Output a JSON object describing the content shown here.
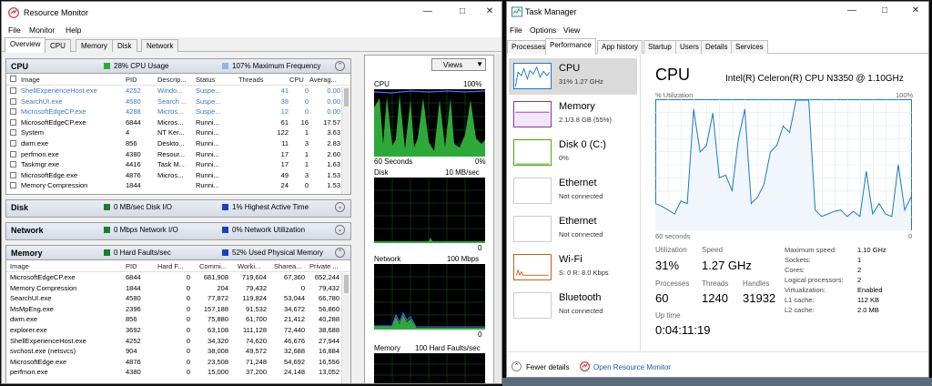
{
  "rm": {
    "title": "Resource Monitor",
    "menu": [
      "File",
      "Monitor",
      "Help"
    ],
    "tabs": [
      "Overview",
      "CPU",
      "Memory",
      "Disk",
      "Network"
    ],
    "cpu": {
      "name": "CPU",
      "ind1": "28% CPU Usage",
      "ind2": "107% Maximum Frequency",
      "columns": [
        "Image",
        "PID",
        "Descrip...",
        "Status",
        "Threads",
        "CPU",
        "Averag..."
      ],
      "rows": [
        [
          "ShellExperienceHost.exe",
          "4252",
          "Windo...",
          "Suspe...",
          "41",
          "0",
          "0.00"
        ],
        [
          "SearchUI.exe",
          "4580",
          "Search ...",
          "Suspe...",
          "38",
          "0",
          "0.00"
        ],
        [
          "MicrosoftEdgeCP.exe",
          "4288",
          "Micros...",
          "Suspe...",
          "12",
          "0",
          "0.00"
        ],
        [
          "MicrosoftEdgeCP.exe",
          "6844",
          "Micros...",
          "Runni...",
          "61",
          "16",
          "17.57"
        ],
        [
          "System",
          "4",
          "NT Ker...",
          "Runni...",
          "122",
          "1",
          "3.63"
        ],
        [
          "dwm.exe",
          "856",
          "Deskto...",
          "Runni...",
          "11",
          "3",
          "2.83"
        ],
        [
          "perfmon.exe",
          "4380",
          "Resour...",
          "Runni...",
          "17",
          "1",
          "2.60"
        ],
        [
          "Taskmgr.exe",
          "4416",
          "Task M...",
          "Runni...",
          "17",
          "1",
          "1.63"
        ],
        [
          "MicrosoftEdge.exe",
          "4876",
          "Micros...",
          "Runni...",
          "49",
          "3",
          "1.53"
        ],
        [
          "Memory Compression",
          "1844",
          "",
          "Runni...",
          "24",
          "0",
          "1.53"
        ]
      ]
    },
    "disk": {
      "name": "Disk",
      "ind1": "0 MB/sec Disk I/O",
      "ind2": "1% Highest Active Time"
    },
    "network": {
      "name": "Network",
      "ind1": "0 Mbps Network I/O",
      "ind2": "0% Network Utilization"
    },
    "memory": {
      "name": "Memory",
      "ind1": "0 Hard Faults/sec",
      "ind2": "52% Used Physical Memory",
      "columns": [
        "Image",
        "PID",
        "Hard F...",
        "Commi...",
        "Worki...",
        "Sharea...",
        "Private ..."
      ],
      "rows": [
        [
          "MicrosoftEdgeCP.exe",
          "6844",
          "0",
          "681,908",
          "719,604",
          "67,360",
          "652,244"
        ],
        [
          "Memory Compression",
          "1844",
          "0",
          "204",
          "79,432",
          "0",
          "79,432"
        ],
        [
          "SearchUI.exe",
          "4580",
          "0",
          "77,872",
          "119,824",
          "53,044",
          "66,780"
        ],
        [
          "MsMpEng.exe",
          "2396",
          "0",
          "157,188",
          "91,532",
          "34,672",
          "56,860"
        ],
        [
          "dwm.exe",
          "856",
          "0",
          "75,880",
          "61,700",
          "21,412",
          "40,288"
        ],
        [
          "explorer.exe",
          "3692",
          "0",
          "63,108",
          "111,128",
          "72,440",
          "38,688"
        ],
        [
          "ShellExperienceHost.exe",
          "4252",
          "0",
          "34,320",
          "74,620",
          "46,676",
          "27,944"
        ],
        [
          "svchost.exe (netsvcs)",
          "904",
          "0",
          "38,008",
          "49,572",
          "32,688",
          "16,884"
        ],
        [
          "MicrosoftEdge.exe",
          "4876",
          "0",
          "23,508",
          "71,248",
          "54,692",
          "16,556"
        ],
        [
          "perfmon.exe",
          "4380",
          "0",
          "15,000",
          "37,200",
          "24,148",
          "13,052"
        ]
      ]
    },
    "views_label": "Views",
    "graphs": [
      {
        "label": "CPU",
        "max": "100%",
        "foot_left": "60 Seconds",
        "foot_right": "0%"
      },
      {
        "label": "Disk",
        "max": "10 MB/sec",
        "foot_right": "0"
      },
      {
        "label": "Network",
        "max": "100 Mbps",
        "foot_right": "0"
      },
      {
        "label": "Memory",
        "max": "100 Hard Faults/sec"
      }
    ],
    "colors": {
      "green": "#2fa83a",
      "blue": "#2b5bd6",
      "lightblue": "#8fb7e6"
    }
  },
  "tm": {
    "title": "Task Manager",
    "menu": [
      "File",
      "Options",
      "View"
    ],
    "tabs": [
      "Processes",
      "Performance",
      "App history",
      "Startup",
      "Users",
      "Details",
      "Services"
    ],
    "resources": [
      {
        "name": "CPU",
        "sub": "31%  1.27 GHz",
        "color": "#1979ca"
      },
      {
        "name": "Memory",
        "sub": "2.1/3.8 GB (55%)",
        "color": "#8b2fa8"
      },
      {
        "name": "Disk 0 (C:)",
        "sub": "0%",
        "color": "#4da60c"
      },
      {
        "name": "Ethernet",
        "sub": "Not connected",
        "color": "#cccccc"
      },
      {
        "name": "Ethernet",
        "sub": "Not connected",
        "color": "#cccccc"
      },
      {
        "name": "Wi-Fi",
        "sub": "S: 0  R: 8.0 Kbps",
        "color": "#c95e0d"
      },
      {
        "name": "Bluetooth",
        "sub": "Not connected",
        "color": "#cccccc"
      }
    ],
    "detail": {
      "title": "CPU",
      "cpu_model": "Intel(R) Celeron(R) CPU N3350 @ 1.10GHz",
      "util_label": "% Utilization",
      "util_max": "100%",
      "span_label": "60 seconds",
      "span_end": "0",
      "stats": {
        "utilization_label": "Utilization",
        "utilization": "31%",
        "speed_label": "Speed",
        "speed": "1.27 GHz",
        "processes_label": "Processes",
        "processes": "60",
        "threads_label": "Threads",
        "threads": "1240",
        "handles_label": "Handles",
        "handles": "31932",
        "uptime_label": "Up time",
        "uptime": "0:04:11:19"
      },
      "specs": [
        [
          "Maximum speed:",
          "1.10 GHz"
        ],
        [
          "Sockets:",
          "1"
        ],
        [
          "Cores:",
          "2"
        ],
        [
          "Logical processors:",
          "2"
        ],
        [
          "Virtualization:",
          "Enabled"
        ],
        [
          "L1 cache:",
          "112 KB"
        ],
        [
          "L2 cache:",
          "2.0 MB"
        ]
      ]
    },
    "footer": {
      "fewer": "Fewer details",
      "open_rm": "Open Resource Monitor"
    }
  },
  "chart_data": {
    "type": "line",
    "title": "CPU",
    "ylabel": "% Utilization",
    "xlabel": "60 seconds",
    "ylim": [
      0,
      100
    ],
    "series": [
      {
        "values": [
          20,
          18,
          15,
          12,
          22,
          20,
          93,
          60,
          65,
          90,
          40,
          42,
          30,
          70,
          93,
          20,
          25,
          35,
          60,
          65,
          80,
          75,
          100,
          100,
          100,
          15,
          10,
          12,
          14,
          15,
          10,
          14,
          10,
          45,
          12,
          20,
          12,
          10,
          50,
          15,
          25
        ]
      }
    ]
  }
}
